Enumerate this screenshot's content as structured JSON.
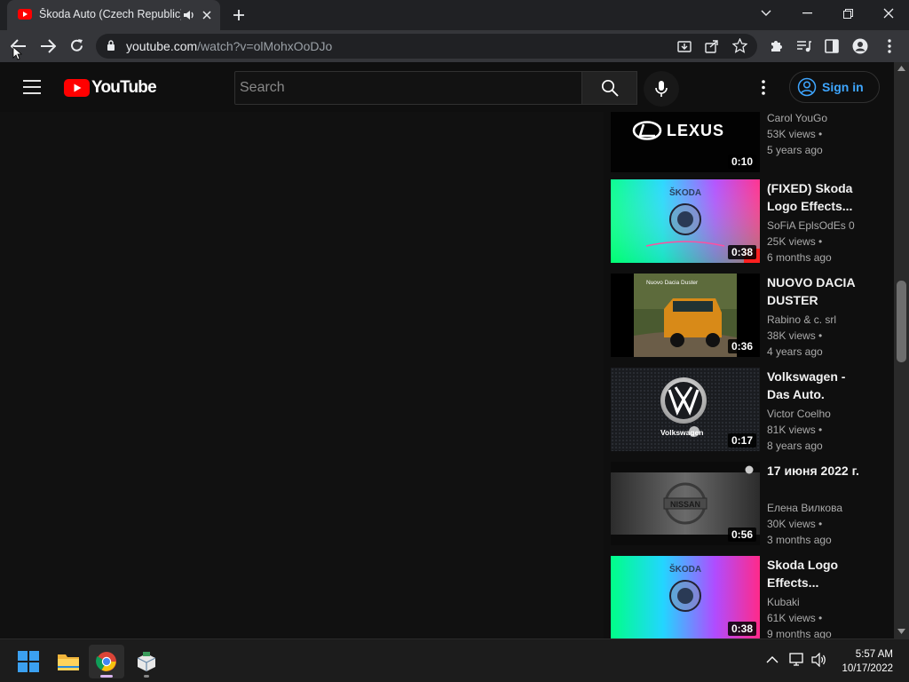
{
  "browser": {
    "tab_title": "Škoda Auto (Czech Republic)",
    "url_host": "youtube.com",
    "url_path": "/watch?v=olMohxOoDJo"
  },
  "youtube": {
    "logo_text": "YouTube",
    "search_placeholder": "Search",
    "signin_label": "Sign in"
  },
  "recommendations": [
    {
      "thumb": "lexus",
      "title": "",
      "channel": "Carol YouGo",
      "views": "53K views •",
      "age": "5 years ago",
      "duration": "0:10"
    },
    {
      "thumb": "skoda",
      "title": "(FIXED) Skoda Logo Effects...",
      "channel": "SoFiA EplsOdEs 0",
      "views": "25K views •",
      "age": "6 months ago",
      "duration": "0:38"
    },
    {
      "thumb": "dacia",
      "title": "NUOVO DACIA DUSTER",
      "channel": "Rabino & c. srl",
      "views": "38K views •",
      "age": "4 years ago",
      "duration": "0:36"
    },
    {
      "thumb": "vw",
      "title": "Volkswagen - Das Auto.",
      "channel": "Victor Coelho",
      "views": "81K views •",
      "age": "8 years ago",
      "duration": "0:17"
    },
    {
      "thumb": "nissan",
      "title": "17 июня 2022 г.",
      "channel": "Елена Вилкова",
      "views": "30K views •",
      "age": "3 months ago",
      "duration": "0:56"
    },
    {
      "thumb": "skoda2",
      "title": "Skoda Logo Effects...",
      "channel": "Kubaki",
      "views": "61K views •",
      "age": "9 months ago",
      "duration": "0:38"
    }
  ],
  "thumb_text": {
    "lexus": "LEXUS",
    "skoda": "ŠKODA",
    "vw": "Volkswagen",
    "nissan": "NISSAN",
    "dacia_caption": "Nuovo Dacia Duster"
  },
  "taskbar": {
    "time": "5:57 AM",
    "date": "10/17/2022"
  },
  "colors": {
    "accent_blue": "#3ea6ff",
    "youtube_red": "#ff0000"
  }
}
